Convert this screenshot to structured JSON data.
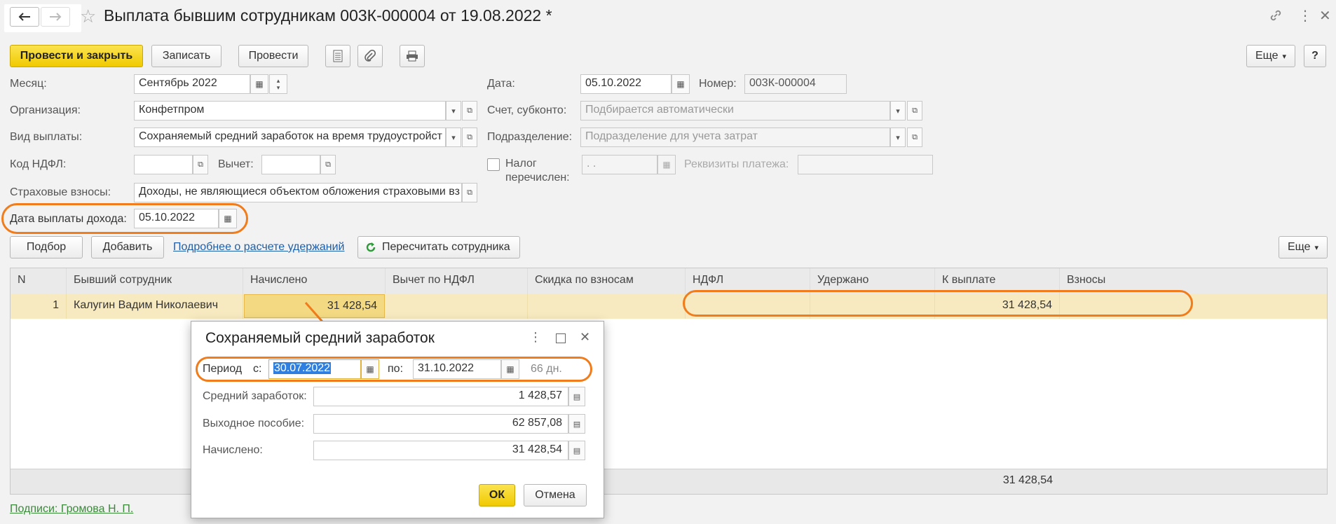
{
  "window": {
    "title": "Выплата бывшим сотрудникам 003К-000004 от 19.08.2022 *",
    "back_icon": "arrow-left-icon",
    "forward_icon": "arrow-right-icon",
    "star_glyph": "☆",
    "link_glyph": "🔗",
    "menu_glyph": "⋮",
    "close_glyph": "✕"
  },
  "toolbar": {
    "post_close": "Провести и закрыть",
    "save": "Записать",
    "post": "Провести",
    "more": "Еще",
    "more_arrow": "▾",
    "help": "?"
  },
  "form": {
    "month_label": "Месяц:",
    "month_value": "Сентябрь 2022",
    "org_label": "Организация:",
    "org_value": "Конфетпром",
    "payment_type_label": "Вид выплаты:",
    "payment_type_value": "Сохраняемый средний заработок на время трудоустройст",
    "ndfl_code_label": "Код НДФЛ:",
    "ndfl_code_value": "",
    "deduction_label": "Вычет:",
    "deduction_value": "",
    "insurance_label": "Страховые взносы:",
    "insurance_value": "Доходы, не являющиеся объектом обложения страховыми вз",
    "income_date_label": "Дата выплаты дохода:",
    "income_date_value": "05.10.2022",
    "date_label": "Дата:",
    "date_value": "05.10.2022",
    "number_label": "Номер:",
    "number_value": "003К-000004",
    "account_label": "Счет, субконто:",
    "account_placeholder": "Подбирается автоматически",
    "department_label": "Подразделение:",
    "department_placeholder": "Подразделение для учета затрат",
    "tax_paid_label_1": "Налог",
    "tax_paid_label_2": "перечислен:",
    "tax_paid_date": " .  .",
    "payment_details_label": "Реквизиты платежа:",
    "payment_details_value": ""
  },
  "table_toolbar": {
    "select": "Подбор",
    "add": "Добавить",
    "details_link": "Подробнее о расчете удержаний",
    "recalc": "Пересчитать сотрудника",
    "more": "Еще",
    "more_arrow": "▾"
  },
  "table": {
    "columns": [
      "N",
      "Бывший сотрудник",
      "Начислено",
      "Вычет по НДФЛ",
      "Скидка по взносам",
      "НДФЛ",
      "Удержано",
      "К выплате",
      "Взносы"
    ],
    "rows": [
      {
        "n": "1",
        "employee": "Калугин Вадим Николаевич",
        "accrued": "31 428,54",
        "deduction": "",
        "discount": "",
        "ndfl": "",
        "withheld": "",
        "to_pay": "31 428,54",
        "contributions": ""
      }
    ],
    "footer_to_pay": "31 428,54"
  },
  "signatures": "Подписи: Громова Н. П.",
  "dialog": {
    "title": "Сохраняемый средний заработок",
    "period_label": "Период",
    "from_label": "с:",
    "from_value": "30.07.2022",
    "to_label": "по:",
    "to_value": "31.10.2022",
    "days": "66 дн.",
    "avg_label": "Средний заработок:",
    "avg_value": "1 428,57",
    "severance_label": "Выходное пособие:",
    "severance_value": "62 857,08",
    "accrued_label": "Начислено:",
    "accrued_value": "31 428,54",
    "ok": "ОК",
    "cancel": "Отмена",
    "menu_glyph": "⋮",
    "close_glyph": "✕"
  },
  "colors": {
    "accent_yellow": "#f0ca00",
    "highlight_orange": "#f07c1b",
    "selected_row": "#f8eac0",
    "link_blue": "#1f5ea8",
    "selection_blue": "#2f7fe0"
  }
}
